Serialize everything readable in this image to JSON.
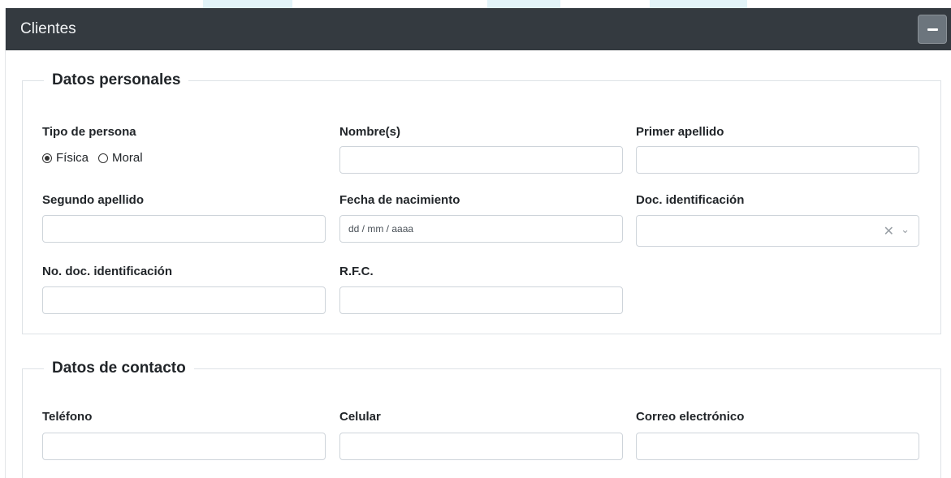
{
  "panel": {
    "title": "Clientes"
  },
  "datos_personales": {
    "legend": "Datos personales",
    "tipo_persona": {
      "label": "Tipo de persona",
      "options": [
        {
          "label": "Física",
          "checked": true
        },
        {
          "label": "Moral",
          "checked": false
        }
      ]
    },
    "nombre": {
      "label": "Nombre(s)",
      "value": ""
    },
    "primer_apellido": {
      "label": "Primer apellido",
      "value": ""
    },
    "segundo_apellido": {
      "label": "Segundo apellido",
      "value": ""
    },
    "fecha_nacimiento": {
      "label": "Fecha de nacimiento",
      "placeholder": "dd / mm / aaaa"
    },
    "doc_identificacion": {
      "label": "Doc. identificación",
      "value": "",
      "clear_glyph": "✕",
      "chevron_glyph": "⌄"
    },
    "no_doc_identificacion": {
      "label": "No. doc. identificación",
      "value": ""
    },
    "rfc": {
      "label": "R.F.C.",
      "value": ""
    }
  },
  "datos_contacto": {
    "legend": "Datos de contacto",
    "telefono": {
      "label": "Teléfono",
      "value": ""
    },
    "celular": {
      "label": "Celular",
      "value": ""
    },
    "correo": {
      "label": "Correo electrónico",
      "value": ""
    }
  },
  "colors": {
    "header_bg": "#343a40",
    "button_bg": "#6c757d",
    "border": "#dee2e6",
    "input_border": "#ced4da"
  }
}
